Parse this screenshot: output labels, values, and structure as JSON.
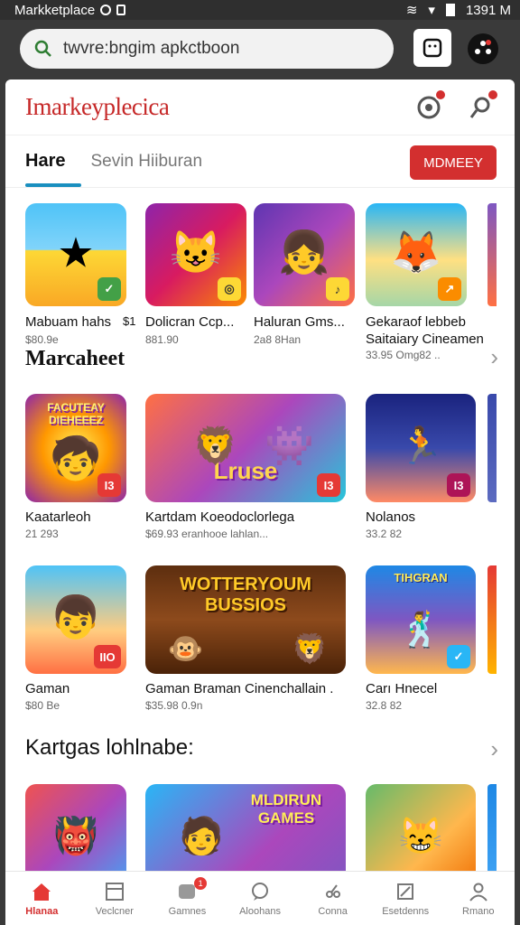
{
  "status": {
    "app": "Markketplace",
    "time": "1391 M"
  },
  "browser": {
    "url": "twvre:bngim apkctboon"
  },
  "header": {
    "brand": "Imarkeyplecica"
  },
  "tabs": [
    {
      "label": "Hare"
    },
    {
      "label": "Sevin Hiiburan"
    }
  ],
  "cta": {
    "label": "MDMEEY"
  },
  "row1": [
    {
      "title": "Mabuam hahs",
      "sub": "$80.9e"
    },
    {
      "title": "Dolicran Ccp...",
      "sub": "881.90"
    },
    {
      "title": "Haluran Gms...",
      "sub": "2a8 8Han"
    },
    {
      "title": "Gekaraof lebbeb",
      "title2": "Saitaiary Cineamen",
      "sub": "33.95 Omg82 .."
    }
  ],
  "row1_prefix": "$1",
  "section2": {
    "title": "Marcaheet"
  },
  "row2": [
    {
      "title": "Kaatarleoh",
      "sub": "21 293",
      "badge": "I3",
      "art": "FACUTEAY DIEHEEEZ"
    },
    {
      "title": "Kartdam Koeodoclorlega",
      "sub": "$69.93 eranhooe lahlan...",
      "badge": "I3",
      "art": "Lruse"
    },
    {
      "title": "Nolanos",
      "sub": "33.2 82",
      "badge": "I3"
    }
  ],
  "row3": [
    {
      "title": "Gaman",
      "sub": "$80 Be",
      "badge": "IIO"
    },
    {
      "title": "Gaman Braman Cinenchallain .",
      "sub": "$35.98 0.9n",
      "art": "WOTTERYOUM BUSSIOS"
    },
    {
      "title": "Carı Hnecel",
      "sub": "32.8 82",
      "art": "TIHGRAN"
    }
  ],
  "section3": {
    "title": "Kartgas lohlnabe:"
  },
  "row4": [
    {
      "art": ""
    },
    {
      "art": "MLDIRUN GAMES"
    },
    {
      "art": ""
    }
  ],
  "nav": [
    {
      "label": "Hlanaa",
      "icon": "home-icon"
    },
    {
      "label": "Veclcner",
      "icon": "list-icon"
    },
    {
      "label": "Gamnes",
      "icon": "games-icon",
      "badge": "1"
    },
    {
      "label": "Aloohans",
      "icon": "chat-icon"
    },
    {
      "label": "Conna",
      "icon": "tools-icon"
    },
    {
      "label": "Esetdenns",
      "icon": "store-icon"
    },
    {
      "label": "Rmano",
      "icon": "profile-icon"
    }
  ],
  "colors": {
    "accent": "#d32f2f",
    "tab_underline": "#1a8fbf"
  }
}
